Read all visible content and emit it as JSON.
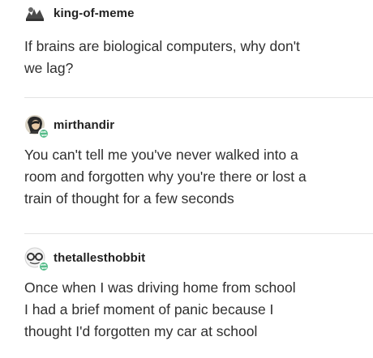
{
  "posts": [
    {
      "username": "king-of-meme",
      "avatar_icon": "meme-avatar-icon",
      "lines": [
        "If brains are biological computers, why don't",
        "we lag?"
      ]
    },
    {
      "username": "mirthandir",
      "avatar_icon": "person-avatar-icon",
      "reblog_icon": "reblog-icon",
      "lines": [
        "You can't tell me you've never walked into a",
        "room and forgotten why you're there or lost a",
        "train of thought for a few seconds"
      ]
    },
    {
      "username": "thetallesthobbit",
      "avatar_icon": "glasses-avatar-icon",
      "reblog_icon": "reblog-icon",
      "lines": [
        "Once when I was driving home from school",
        "I had a brief moment of panic because I",
        "thought I'd forgotten my car at school"
      ]
    }
  ],
  "colors": {
    "text": "#2f2f2f",
    "username": "#222222",
    "divider": "#e3e3e3",
    "reblog_badge": "#56bc8a"
  }
}
